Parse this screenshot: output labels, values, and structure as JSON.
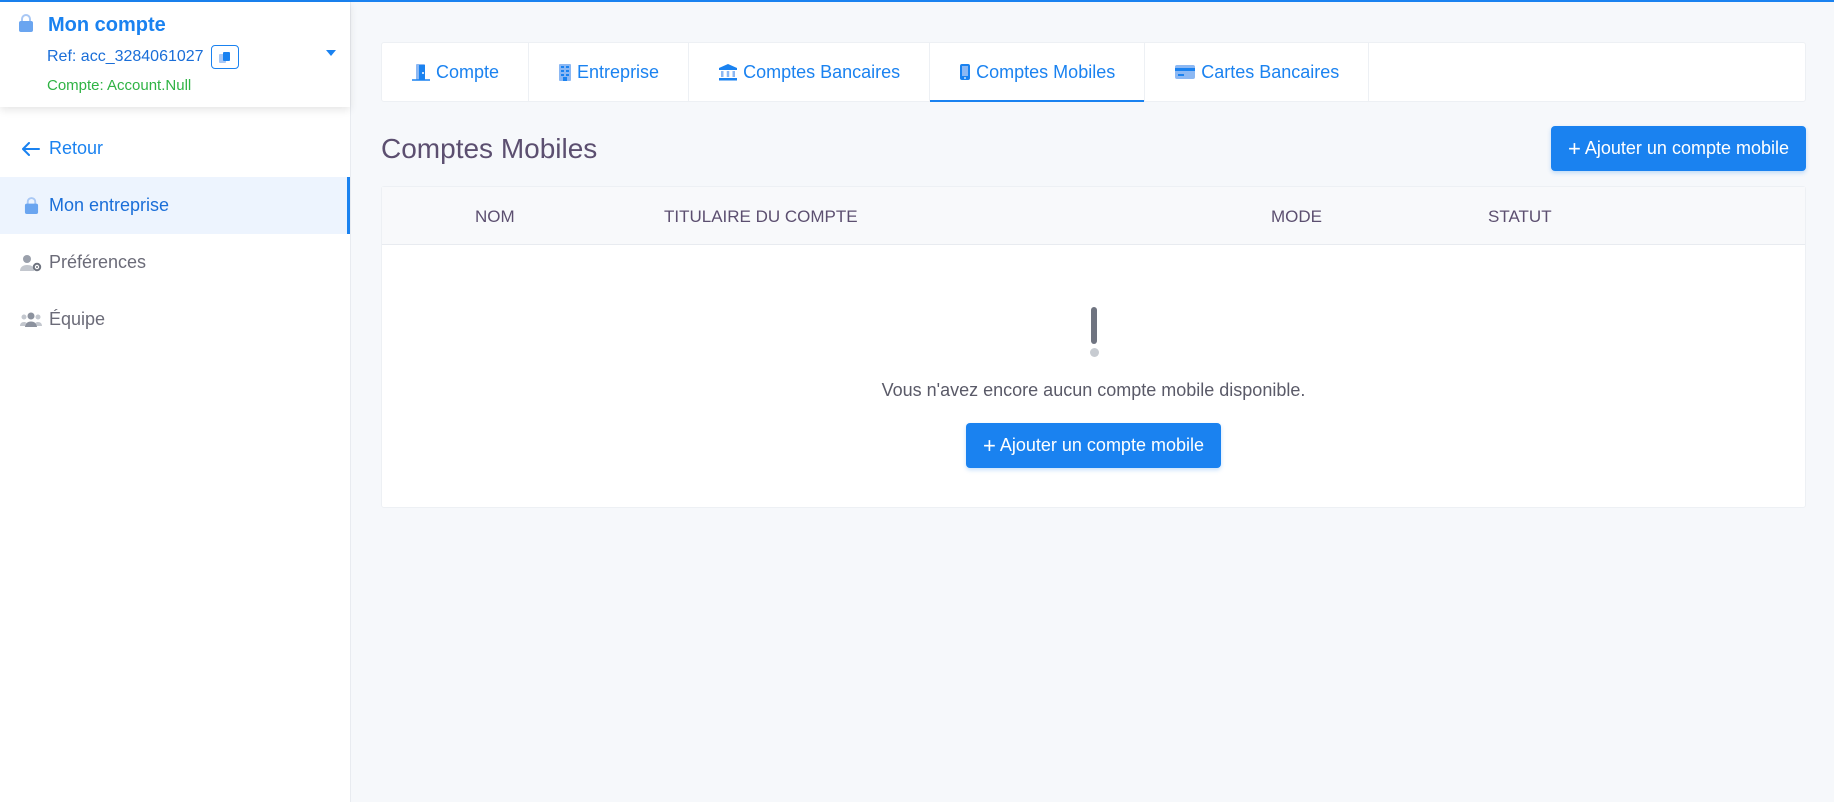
{
  "account": {
    "title": "Mon compte",
    "ref": "Ref: acc_3284061027",
    "status": "Compte: Account.Null"
  },
  "nav": {
    "back": "Retour",
    "items": [
      {
        "label": "Mon entreprise",
        "icon": "lock-icon"
      },
      {
        "label": "Préférences",
        "icon": "user-gear-icon"
      },
      {
        "label": "Équipe",
        "icon": "team-icon"
      }
    ]
  },
  "tabs": [
    {
      "label": "Compte",
      "icon": "door-icon"
    },
    {
      "label": "Entreprise",
      "icon": "building-icon"
    },
    {
      "label": "Comptes Bancaires",
      "icon": "bank-icon"
    },
    {
      "label": "Comptes Mobiles",
      "icon": "mobile-icon",
      "active": true
    },
    {
      "label": "Cartes Bancaires",
      "icon": "credit-card-icon"
    }
  ],
  "page": {
    "title": "Comptes Mobiles",
    "add_button": "Ajouter un compte mobile"
  },
  "table": {
    "columns": [
      "NOM",
      "TITULAIRE DU COMPTE",
      "MODE",
      "STATUT"
    ],
    "empty_text": "Vous n'avez encore aucun compte mobile disponible.",
    "empty_button": "Ajouter un compte mobile"
  },
  "colors": {
    "accent": "#1a82f0",
    "status_green": "#2fb344",
    "title": "#5c4f70"
  }
}
